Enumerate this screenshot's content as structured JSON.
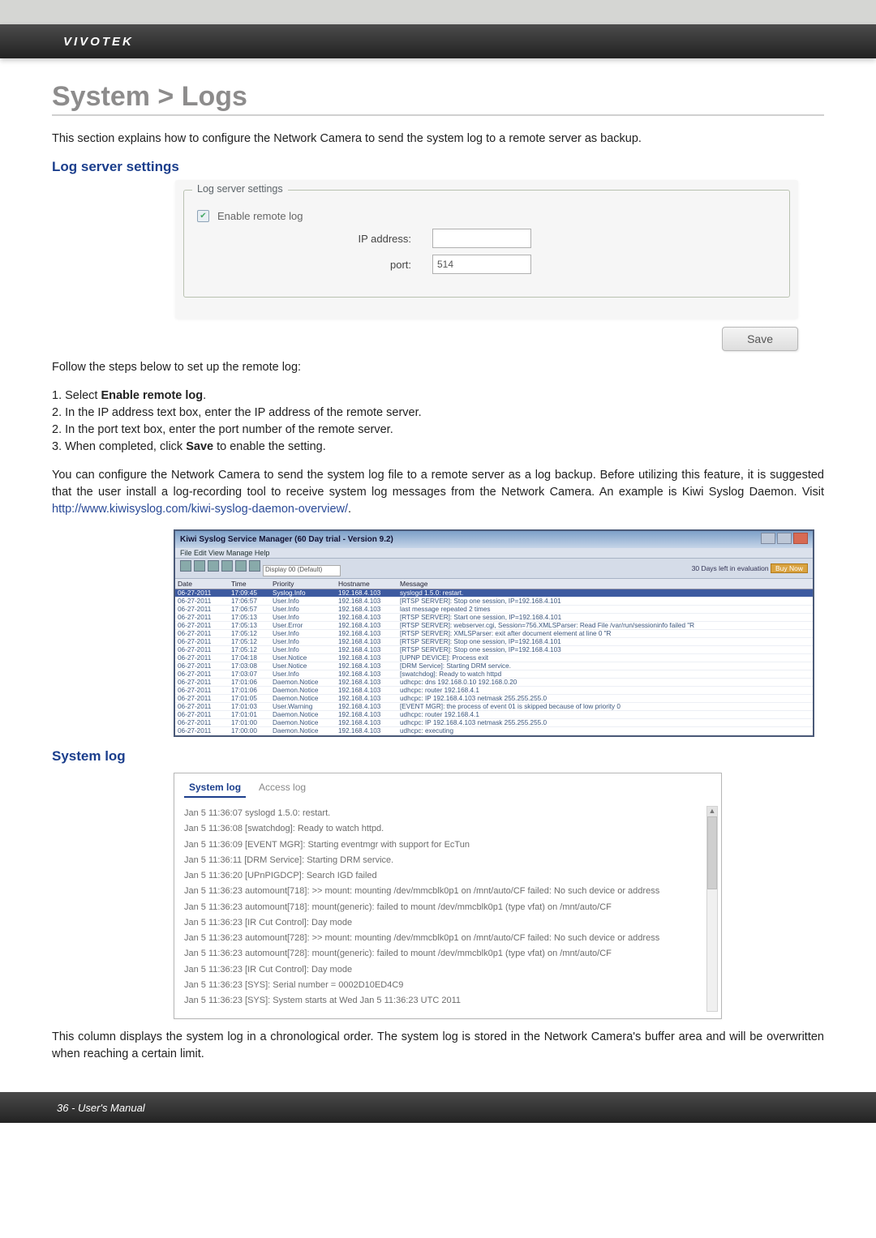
{
  "brand": "VIVOTEK",
  "pageTitle": "System > Logs",
  "intro": "This section explains how to configure the Network Camera to send the system log to a remote server as backup.",
  "sections": {
    "logServerSettings": {
      "heading": "Log server settings",
      "panel": {
        "legend": "Log server settings",
        "enableLabel": "Enable remote log",
        "ipLabel": "IP address:",
        "portLabel": "port:",
        "portValue": "514",
        "saveLabel": "Save"
      },
      "followSteps": "Follow the steps below to set up the remote log:",
      "steps": {
        "s1": "1. Select ",
        "s1b": "Enable remote log",
        "s1c": ".",
        "s2": "2. In the IP address text box, enter the IP address of the remote server.",
        "s3": "2. In the port text box, enter the port number of the remote server.",
        "s4a": "3. When completed, click ",
        "s4b": "Save",
        "s4c": " to enable the setting."
      },
      "paragraph2a": "You can configure the Network Camera to send the system log file to a remote server as a log backup. Before utilizing this feature, it is suggested that the user install a log-recording tool to receive system log messages from the Network Camera. An example is Kiwi Syslog Daemon. Visit ",
      "paragraph2link": "http://www.kiwisyslog.com/kiwi-syslog-daemon-overview/",
      "paragraph2b": "."
    },
    "kiwi": {
      "title": "Kiwi Syslog Service Manager (60 Day trial - Version 9.2)",
      "menubar": "File   Edit   View   Manage   Help",
      "dropdown": "Display 00 (Default)",
      "status": "30 Days left in evaluation",
      "cols": {
        "date": "Date",
        "time": "Time",
        "priority": "Priority",
        "hostname": "Hostname",
        "message": "Message"
      },
      "rows": [
        {
          "date": "06-27-2011",
          "time": "17:09:45",
          "pri": "Syslog.Info",
          "host": "192.168.4.103",
          "msg": "syslogd 1.5.0: restart.",
          "hl": true
        },
        {
          "date": "06-27-2011",
          "time": "17:06:57",
          "pri": "User.Info",
          "host": "192.168.4.103",
          "msg": "[RTSP SERVER]: Stop one session, IP=192.168.4.101"
        },
        {
          "date": "06-27-2011",
          "time": "17:06:57",
          "pri": "User.Info",
          "host": "192.168.4.103",
          "msg": "last message repeated 2 times"
        },
        {
          "date": "06-27-2011",
          "time": "17:05:13",
          "pri": "User.Info",
          "host": "192.168.4.103",
          "msg": "[RTSP SERVER]: Start one session, IP=192.168.4.101"
        },
        {
          "date": "06-27-2011",
          "time": "17:05:13",
          "pri": "User.Error",
          "host": "192.168.4.103",
          "msg": "[RTSP SERVER]: webserver.cgi, Session=756.XMLSParser: Read File /var/run/sessioninfo failed \"R"
        },
        {
          "date": "06-27-2011",
          "time": "17:05:12",
          "pri": "User.Info",
          "host": "192.168.4.103",
          "msg": "[RTSP SERVER]: XMLSParser: exit after document element at line 0 \"R"
        },
        {
          "date": "06-27-2011",
          "time": "17:05:12",
          "pri": "User.Info",
          "host": "192.168.4.103",
          "msg": "[RTSP SERVER]: Stop one session, IP=192.168.4.101"
        },
        {
          "date": "06-27-2011",
          "time": "17:05:12",
          "pri": "User.Info",
          "host": "192.168.4.103",
          "msg": "[RTSP SERVER]: Stop one session, IP=192.168.4.103"
        },
        {
          "date": "06-27-2011",
          "time": "17:04:18",
          "pri": "User.Notice",
          "host": "192.168.4.103",
          "msg": "[UPNP DEVICE]: Process exit"
        },
        {
          "date": "06-27-2011",
          "time": "17:03:08",
          "pri": "User.Notice",
          "host": "192.168.4.103",
          "msg": "[DRM Service]: Starting DRM service."
        },
        {
          "date": "06-27-2011",
          "time": "17:03:07",
          "pri": "User.Info",
          "host": "192.168.4.103",
          "msg": "[swatchdog]: Ready to watch httpd"
        },
        {
          "date": "06-27-2011",
          "time": "17:01:06",
          "pri": "Daemon.Notice",
          "host": "192.168.4.103",
          "msg": "udhcpc: dns 192.168.0.10 192.168.0.20"
        },
        {
          "date": "06-27-2011",
          "time": "17:01:06",
          "pri": "Daemon.Notice",
          "host": "192.168.4.103",
          "msg": "udhcpc: router 192.168.4.1"
        },
        {
          "date": "06-27-2011",
          "time": "17:01:05",
          "pri": "Daemon.Notice",
          "host": "192.168.4.103",
          "msg": "udhcpc: IP 192.168.4.103  netmask 255.255.255.0"
        },
        {
          "date": "06-27-2011",
          "time": "17:01:03",
          "pri": "User.Warning",
          "host": "192.168.4.103",
          "msg": "[EVENT MGR]: the process of event 01 is skipped because of low priority 0"
        },
        {
          "date": "06-27-2011",
          "time": "17:01:01",
          "pri": "Daemon.Notice",
          "host": "192.168.4.103",
          "msg": "udhcpc: router 192.168.4.1"
        },
        {
          "date": "06-27-2011",
          "time": "17:01:00",
          "pri": "Daemon.Notice",
          "host": "192.168.4.103",
          "msg": "udhcpc: IP 192.168.4.103  netmask 255.255.255.0"
        },
        {
          "date": "06-27-2011",
          "time": "17:00:00",
          "pri": "Daemon.Notice",
          "host": "192.168.4.103",
          "msg": "udhcpc: executing"
        }
      ]
    },
    "systemLog": {
      "heading": "System log",
      "tabs": {
        "active": "System log",
        "inactive": "Access log"
      },
      "lines": [
        "Jan 5 11:36:07 syslogd 1.5.0: restart.",
        "Jan 5 11:36:08 [swatchdog]: Ready to watch httpd.",
        "Jan 5 11:36:09 [EVENT MGR]: Starting eventmgr with support for EcTun",
        "Jan 5 11:36:11 [DRM Service]: Starting DRM service.",
        "Jan 5 11:36:20 [UPnPIGDCP]: Search IGD failed",
        "Jan 5 11:36:23 automount[718]: >> mount: mounting /dev/mmcblk0p1 on /mnt/auto/CF failed: No such device or address",
        "Jan 5 11:36:23 automount[718]: mount(generic): failed to mount /dev/mmcblk0p1 (type vfat) on /mnt/auto/CF",
        "Jan 5 11:36:23 [IR Cut Control]: Day mode",
        "Jan 5 11:36:23 automount[728]: >> mount: mounting /dev/mmcblk0p1 on /mnt/auto/CF failed: No such device or address",
        "Jan 5 11:36:23 automount[728]: mount(generic): failed to mount /dev/mmcblk0p1 (type vfat) on /mnt/auto/CF",
        "Jan 5 11:36:23 [IR Cut Control]: Day mode",
        "Jan 5 11:36:23 [SYS]: Serial number = 0002D10ED4C9",
        "Jan 5 11:36:23 [SYS]: System starts at Wed Jan 5 11:36:23 UTC 2011"
      ],
      "closingParagraph": "This column displays the system log in a chronological order. The system log is stored in the Network Camera's buffer area and will be overwritten when reaching a certain limit."
    }
  },
  "footer": "36 - User's Manual"
}
